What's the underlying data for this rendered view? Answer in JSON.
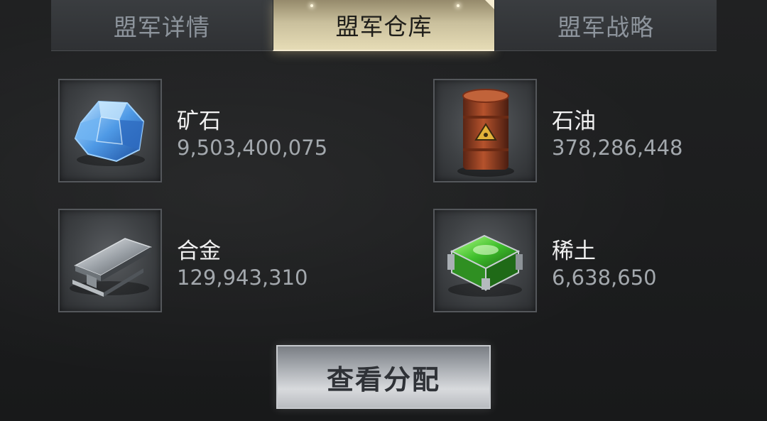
{
  "tabs": [
    {
      "label": "盟军详情",
      "active": false
    },
    {
      "label": "盟军仓库",
      "active": true
    },
    {
      "label": "盟军战略",
      "active": false
    }
  ],
  "resources": [
    {
      "name": "矿石",
      "amount": "9,503,400,075",
      "icon": "ore-crystal-icon"
    },
    {
      "name": "石油",
      "amount": "378,286,448",
      "icon": "oil-barrel-icon"
    },
    {
      "name": "合金",
      "amount": "129,943,310",
      "icon": "alloy-ingot-icon"
    },
    {
      "name": "稀土",
      "amount": "6,638,650",
      "icon": "rare-earth-crate-icon"
    }
  ],
  "actions": {
    "view_distribution": "查看分配"
  },
  "colors": {
    "active_tab": "#d8ceaa",
    "inactive_tab": "#34373a",
    "button": "#c6c9cd",
    "background": "#1d1e1f"
  }
}
